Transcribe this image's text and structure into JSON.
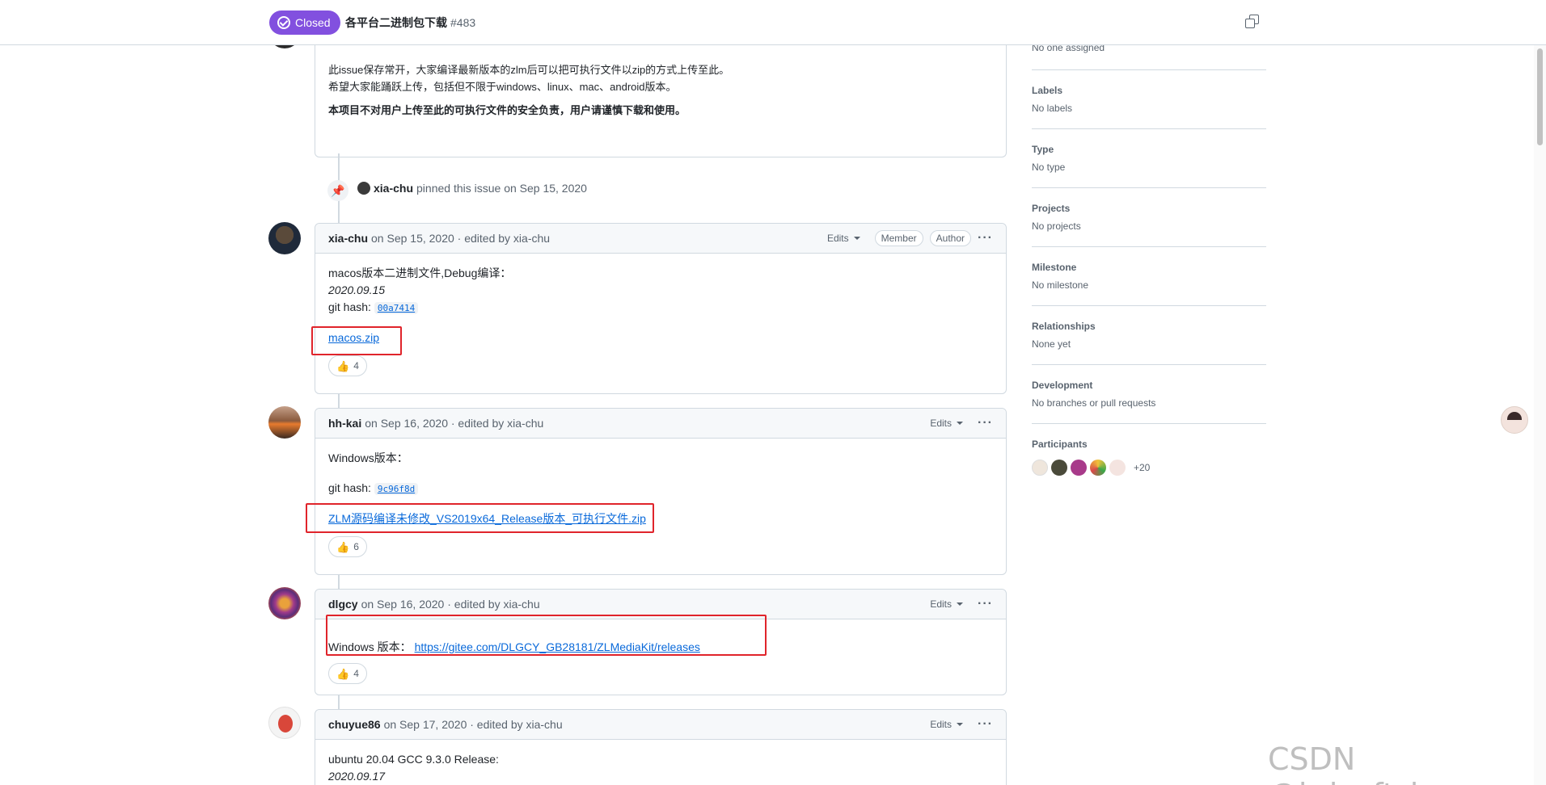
{
  "header": {
    "state": "Closed",
    "title": "各平台二进制包下载",
    "number": "#483"
  },
  "intro": {
    "line1": "此issue保存常开，大家编译最新版本的zlm后可以把可执行文件以zip的方式上传至此。",
    "line2": "希望大家能踊跃上传，包括但不限于windows、linux、mac、android版本。",
    "warning": "本项目不对用户上传至此的可执行文件的安全负责，用户请谨慎下载和使用。"
  },
  "pin_event": {
    "user": "xia-chu",
    "text": "pinned this issue on Sep 15, 2020"
  },
  "comments": [
    {
      "author": "xia-chu",
      "meta": "on Sep 15, 2020 · edited by xia-chu",
      "edits": "Edits",
      "badges": [
        "Member",
        "Author"
      ],
      "line1": "macos版本二进制文件,Debug编译：",
      "date": "2020.09.15",
      "hash_label": "git hash:",
      "hash": "00a7414",
      "link": "macos.zip",
      "reactions": "4"
    },
    {
      "author": "hh-kai",
      "meta": "on Sep 16, 2020 · edited by xia-chu",
      "edits": "Edits",
      "line1": "Windows版本：",
      "hash_label": "git hash:",
      "hash": "9c96f8d",
      "link": "ZLM源码编译未修改_VS2019x64_Release版本_可执行文件.zip",
      "reactions": "6"
    },
    {
      "author": "dlgcy",
      "meta": "on Sep 16, 2020 · edited by xia-chu",
      "edits": "Edits",
      "line1": "Windows 版本：",
      "link": "https://gitee.com/DLGCY_GB28181/ZLMediaKit/releases",
      "reactions": "4"
    },
    {
      "author": "chuyue86",
      "meta": "on Sep 17, 2020 · edited by xia-chu",
      "edits": "Edits",
      "line1": "ubuntu 20.04 GCC 9.3.0 Release:",
      "date": "2020.09.17"
    }
  ],
  "sidebar": {
    "assignees_value": "No one assigned",
    "sections": [
      {
        "title": "Labels",
        "value": "No labels"
      },
      {
        "title": "Type",
        "value": "No type"
      },
      {
        "title": "Projects",
        "value": "No projects"
      },
      {
        "title": "Milestone",
        "value": "No milestone"
      },
      {
        "title": "Relationships",
        "value": "None yet"
      },
      {
        "title": "Development",
        "value": "No branches or pull requests"
      }
    ],
    "participants_title": "Participants",
    "participants_more": "+20"
  },
  "watermark": "CSDN @hdsoft_huge"
}
